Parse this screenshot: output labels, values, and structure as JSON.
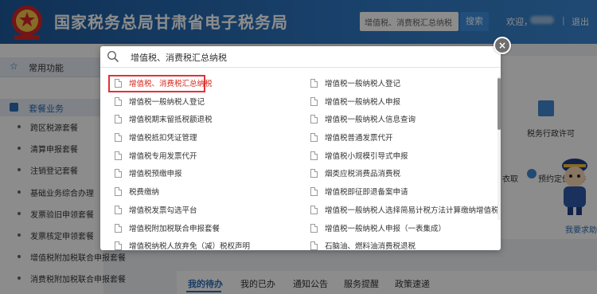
{
  "header": {
    "title": "国家税务总局甘肃省电子税务局",
    "search_placeholder": "增值税、消费税汇总纳税",
    "search_button": "搜索",
    "welcome": "欢迎，",
    "separator": "|",
    "logout": "退出"
  },
  "sidebar": {
    "favorites": "常用功能",
    "packages": "套餐业务",
    "items": [
      "跨区税源套餐",
      "清算申报套餐",
      "注销登记套餐",
      "基础业务综合办理",
      "发票验旧申领套餐",
      "发票核定申领套餐",
      "增值税附加税联合申报套餐",
      "消费税附加税联合申报套餐"
    ]
  },
  "background": {
    "service1": "税务行政许可",
    "service2": "预约定价安排",
    "service3": "衣取",
    "help": "我要求助"
  },
  "bottom_tabs": [
    "我的待办",
    "我的已办",
    "通知公告",
    "服务提醒",
    "政策速递"
  ],
  "modal": {
    "search_value": "增值税、消费税汇总纳税",
    "close_label": "×",
    "left_results": [
      "增值税、消费税汇总纳税",
      "增值税一般纳税人登记",
      "增值税期末留抵税额退税",
      "增值税抵扣凭证管理",
      "增值税专用发票代开",
      "增值税预缴申报",
      "税费缴纳",
      "增值税发票勾选平台",
      "增值税附加税联合申报套餐",
      "增值税纳税人放弃免（减）税权声明"
    ],
    "right_results": [
      "增值税一般纳税人登记",
      "增值税一般纳税人申报",
      "增值税一般纳税人信息查询",
      "增值税普通发票代开",
      "增值税小规模引导式申报",
      "烟类应税消费品消费税",
      "增值税即征即退备案申请",
      "增值税一般纳税人选择简易计税方法计算缴纳增值税",
      "增值税一般纳税人申报（一表集成）",
      "石脑油、燃料油消费税退税"
    ],
    "highlighted_index": 0
  },
  "colors": {
    "header_blue": "#2f78c4",
    "highlight_red": "#e0323a",
    "accent_blue": "#2c6db6"
  }
}
